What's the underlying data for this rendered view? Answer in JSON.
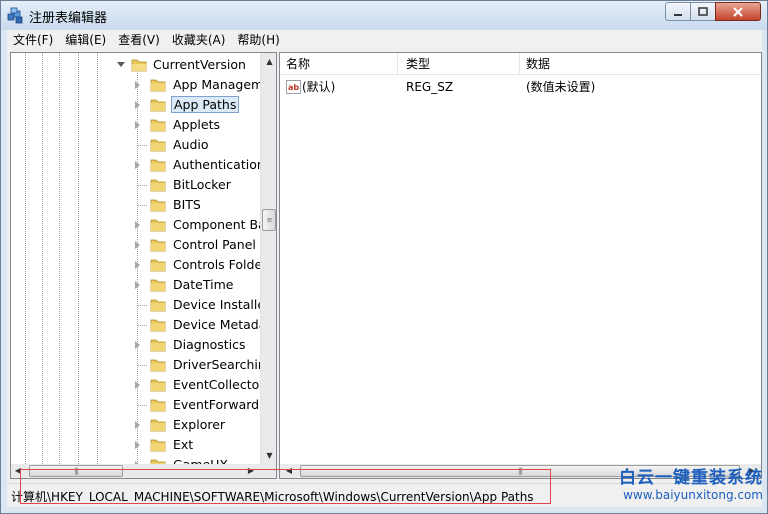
{
  "window": {
    "title": "注册表编辑器"
  },
  "menu": [
    "文件(F)",
    "编辑(E)",
    "查看(V)",
    "收藏夹(A)",
    "帮助(H)"
  ],
  "tree": {
    "root_label": "CurrentVersion",
    "items": [
      {
        "label": "App Managem",
        "has_children": true
      },
      {
        "label": "App Paths",
        "has_children": true,
        "selected": true
      },
      {
        "label": "Applets",
        "has_children": true
      },
      {
        "label": "Audio",
        "has_children": false
      },
      {
        "label": "Authentication",
        "has_children": true
      },
      {
        "label": "BitLocker",
        "has_children": false
      },
      {
        "label": "BITS",
        "has_children": false
      },
      {
        "label": "Component Ba",
        "has_children": true
      },
      {
        "label": "Control Panel",
        "has_children": true
      },
      {
        "label": "Controls Folder",
        "has_children": true
      },
      {
        "label": "DateTime",
        "has_children": true
      },
      {
        "label": "Device Installer",
        "has_children": false
      },
      {
        "label": "Device Metada",
        "has_children": false
      },
      {
        "label": "Diagnostics",
        "has_children": true
      },
      {
        "label": "DriverSearching",
        "has_children": false
      },
      {
        "label": "EventCollector",
        "has_children": true
      },
      {
        "label": "EventForwardin",
        "has_children": false
      },
      {
        "label": "Explorer",
        "has_children": true
      },
      {
        "label": "Ext",
        "has_children": true
      },
      {
        "label": "GameUX",
        "has_children": true
      }
    ]
  },
  "list": {
    "columns": [
      "名称",
      "类型",
      "数据"
    ],
    "rows": [
      {
        "name": "(默认)",
        "type": "REG_SZ",
        "data": "(数值未设置)"
      }
    ]
  },
  "status": {
    "path": "计算机\\HKEY_LOCAL_MACHINE\\SOFTWARE\\Microsoft\\Windows\\CurrentVersion\\App Paths"
  },
  "watermark": {
    "title": "白云一键重装系统",
    "url": "www.baiyunxitong.com"
  },
  "colors": {
    "selection_bg": "#dceaf7",
    "highlight_box": "#e0464a",
    "watermark": "#1c5fbd",
    "folder": "#e8c65a"
  }
}
